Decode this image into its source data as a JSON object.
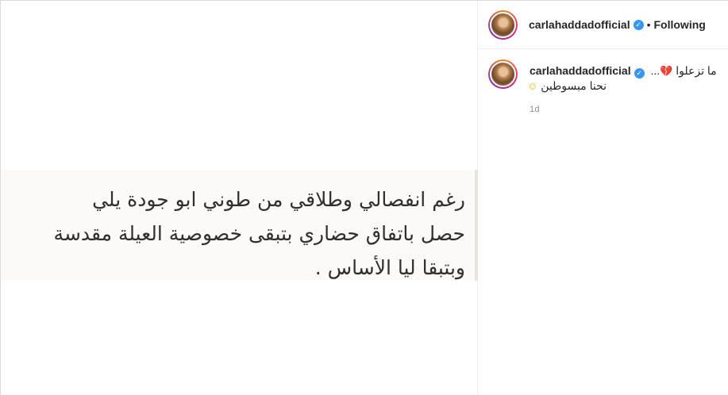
{
  "media": {
    "text": "رغم انفصالي وطلاقي  من طوني ابو جودة يلي\nحصل باتفاق حضاري بتبقى خصوصية العيلة مقدسة\nوبتبقا ليا الأساس   ."
  },
  "header": {
    "username": "carlahaddadofficial",
    "follow_state": "Following",
    "dot": "•",
    "verified_icon": "✓"
  },
  "caption": {
    "username": "carlahaddadofficial",
    "line1_text": "ما تزعلوا",
    "line1_emoji": "💔",
    "ellipsis": "...",
    "line2_text": "نحنا مبسوطين",
    "line2_emoji": "☺",
    "timestamp": "1d",
    "verified_icon": "✓"
  },
  "colors": {
    "verified": "#3897f0",
    "text": "#262626",
    "muted": "#8e8e8e"
  }
}
